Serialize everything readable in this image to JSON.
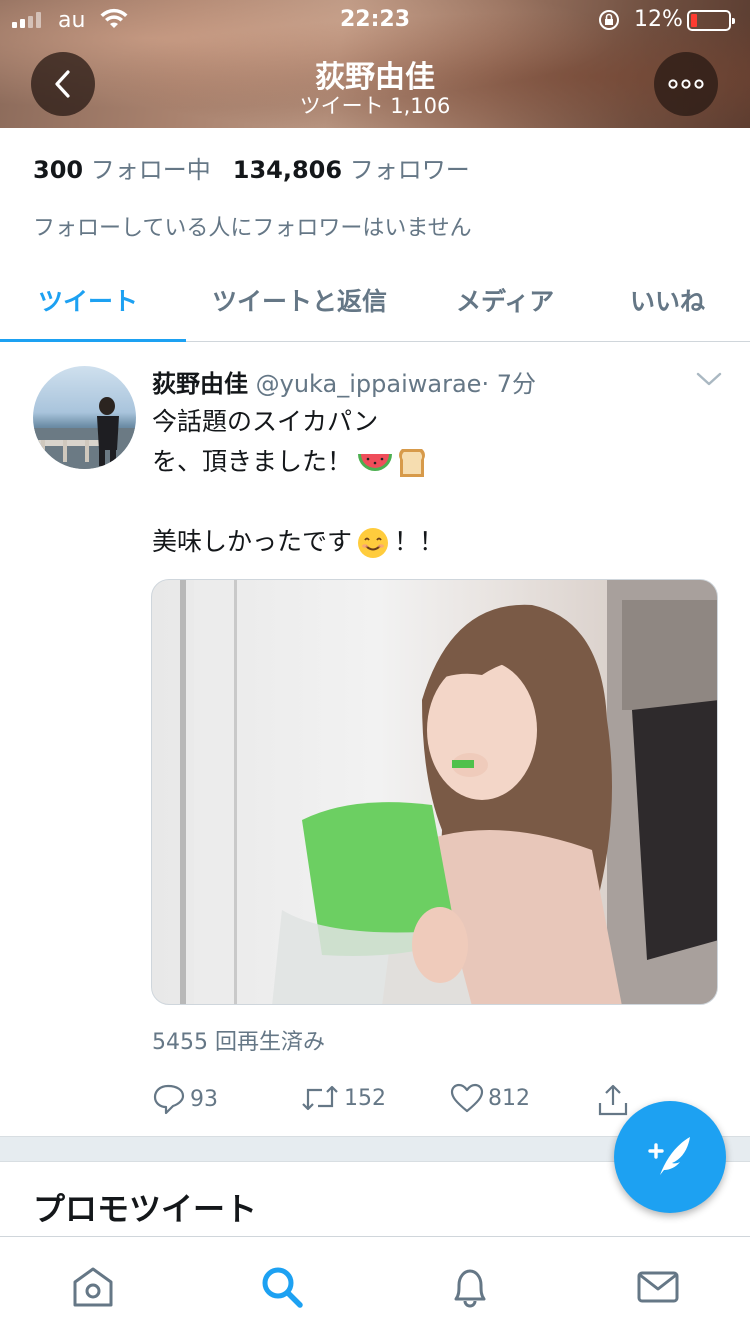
{
  "status_bar": {
    "carrier": "au",
    "time": "22:23",
    "battery_percent": "12%",
    "battery_level": 0.12
  },
  "header": {
    "title": "荻野由佳",
    "subtitle": "ツイート 1,106",
    "back_icon": "chevron-left-icon",
    "more_icon": "ellipsis-icon"
  },
  "profile": {
    "following_count": "300",
    "following_label": "フォロー中",
    "followers_count": "134,806",
    "followers_label": "フォロワー",
    "followed_by_note": "フォローしている人にフォロワーはいません"
  },
  "tabs": [
    {
      "label": "ツイート",
      "active": true
    },
    {
      "label": "ツイートと返信",
      "active": false
    },
    {
      "label": "メディア",
      "active": false
    },
    {
      "label": "いいね",
      "active": false
    }
  ],
  "tweet": {
    "name": "荻野由佳",
    "handle": "@yuka_ippaiwarae",
    "time": "· 7分",
    "lines": [
      "今話題のスイカパン",
      "を、頂きました！",
      "",
      "美味しかったです",
      "！！"
    ],
    "view_count": "5455 回再生済み",
    "reply_count": "93",
    "retweet_count": "152",
    "like_count": "812"
  },
  "promo": {
    "title": "プロモツイート"
  },
  "colors": {
    "accent": "#1da1f2",
    "secondary_text": "#657786",
    "primary_text": "#14171a",
    "divider": "#e6ecf0"
  },
  "bottom_nav": [
    "home-icon",
    "search-icon",
    "notifications-icon",
    "messages-icon"
  ]
}
